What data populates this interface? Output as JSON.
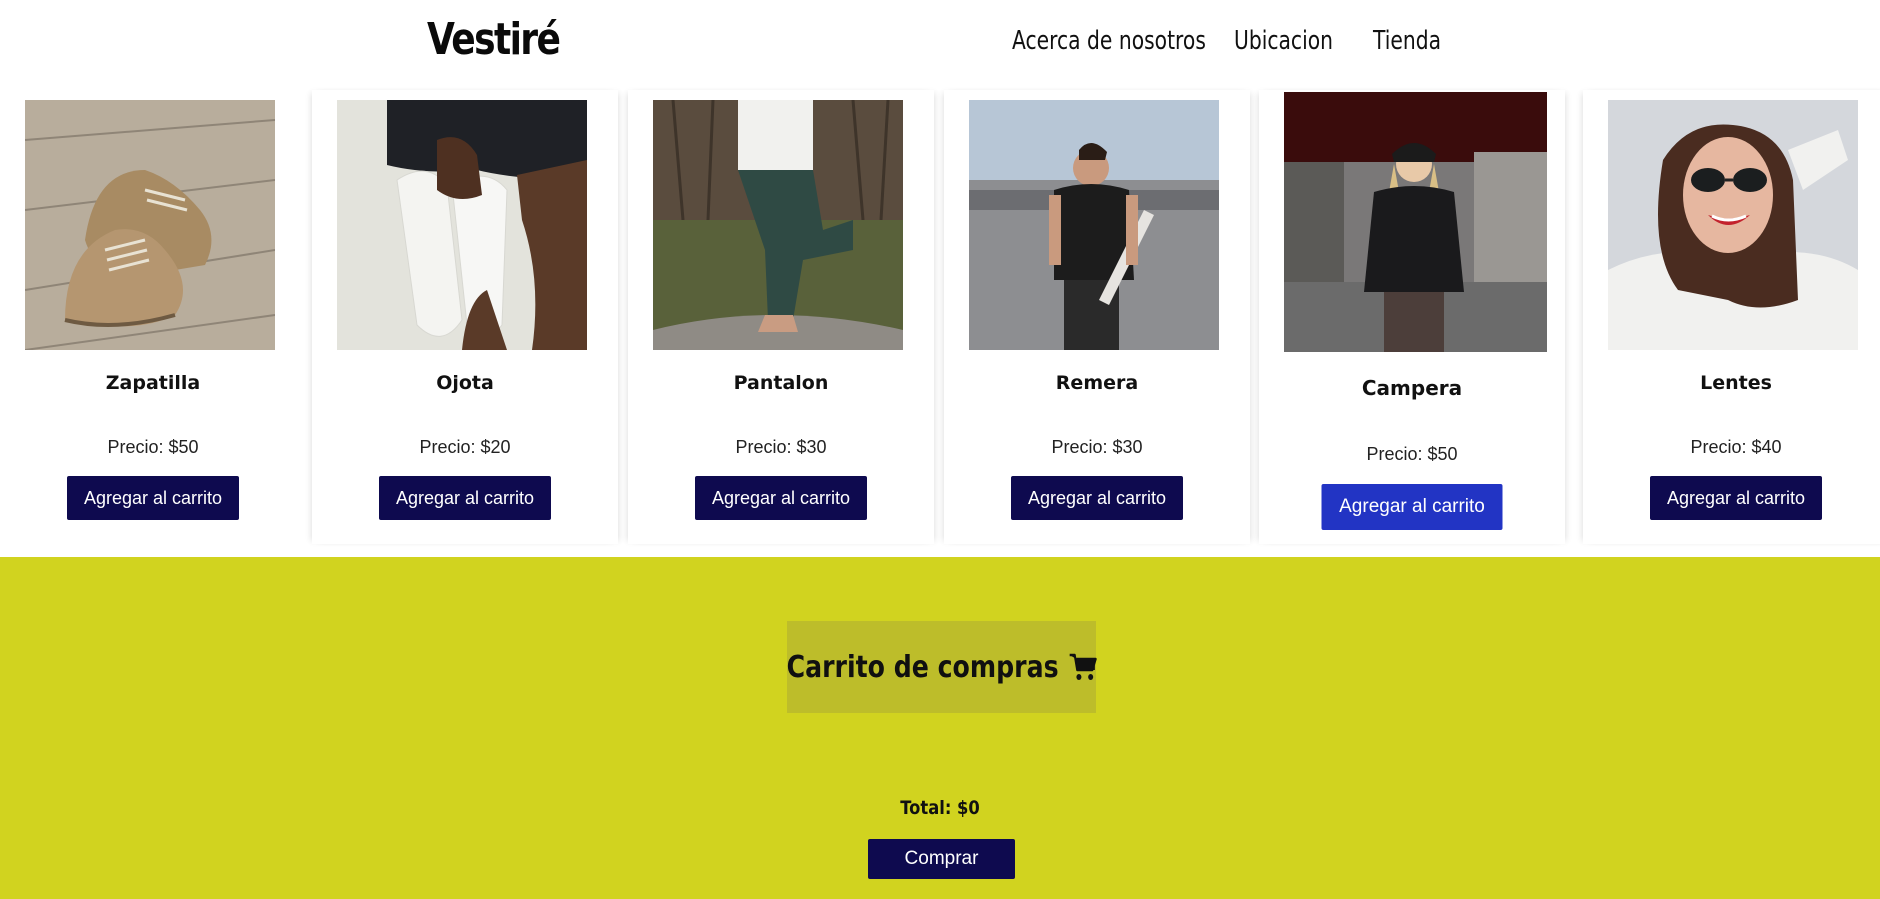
{
  "header": {
    "brand": "Vestiré",
    "nav": [
      {
        "label": "Acerca de nosotros"
      },
      {
        "label": "Ubicacion"
      },
      {
        "label": "Tienda"
      }
    ]
  },
  "products": [
    {
      "name": "Zapatilla",
      "price": "Precio: $50",
      "button": "Agregar al carrito",
      "image_icon": "shoe-photo"
    },
    {
      "name": "Ojota",
      "price": "Precio: $20",
      "button": "Agregar al carrito",
      "image_icon": "flip-flop-photo"
    },
    {
      "name": "Pantalon",
      "price": "Precio: $30",
      "button": "Agregar al carrito",
      "image_icon": "pants-photo"
    },
    {
      "name": "Remera",
      "price": "Precio: $30",
      "button": "Agregar al carrito",
      "image_icon": "tshirt-photo"
    },
    {
      "name": "Campera",
      "price": "Precio: $50",
      "button": "Agregar al carrito",
      "image_icon": "jacket-photo"
    },
    {
      "name": "Lentes",
      "price": "Precio: $40",
      "button": "Agregar al carrito",
      "image_icon": "sunglasses-photo"
    }
  ],
  "cart": {
    "title": "Carrito de compras",
    "icon": "cart-icon",
    "total": "Total: $0",
    "buy_label": "Comprar"
  },
  "colors": {
    "button": "#0e0a4f",
    "button_hover": "#2234c4",
    "cart_bg": "#d1d31f",
    "cart_title_bg": "#bdbd2a"
  }
}
